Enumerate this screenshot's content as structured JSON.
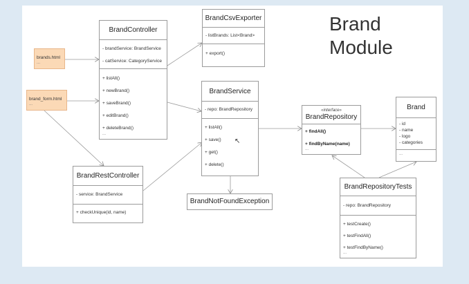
{
  "title": {
    "line1": "Brand",
    "line2": "Module"
  },
  "files": {
    "brands_html": {
      "name": "brands.html",
      "dots": "..."
    },
    "brand_form_html": {
      "name": "brand_form.html",
      "dots": "..."
    }
  },
  "brand_controller": {
    "name": "BrandController",
    "fields": [
      "- brandService: BrandService",
      "- catService: CategoryService"
    ],
    "methods": [
      "+ listAll()",
      "+ newBrand()",
      "+ saveBrand()",
      "+ editBrand()",
      "+ deleteBrand()"
    ],
    "dots": "..."
  },
  "brand_csv_exporter": {
    "name": "BrandCsvExporter",
    "fields": [
      "- listBrands: List<Brand>"
    ],
    "methods": [
      "+ export()"
    ]
  },
  "brand_service": {
    "name": "BrandService",
    "fields": [
      "- repo: BrandRepository"
    ],
    "methods": [
      "+ listAll()",
      "+ save()",
      "+ get()",
      "+ delete()"
    ]
  },
  "brand_repository": {
    "stereotype": "«interface»",
    "name": "BrandRepository",
    "methods": [
      "+ findAll()",
      "+ findByName(name)"
    ],
    "dots": "..."
  },
  "brand": {
    "name": "Brand",
    "fields": [
      "- id",
      "- name",
      "- logo",
      "- categories"
    ],
    "dots": "..."
  },
  "brand_rest_controller": {
    "name": "BrandRestController",
    "fields": [
      "- service: BrandService"
    ],
    "methods": [
      "+ checkUnique(id, name)"
    ]
  },
  "brand_not_found": {
    "name": "BrandNotFoundException"
  },
  "brand_repository_tests": {
    "name": "BrandRepositoryTests",
    "fields": [
      "- repo: BrandRepository"
    ],
    "methods": [
      "+ testCreate()",
      "+ testFindAll()",
      "+ testFindByName()"
    ],
    "dots": "..."
  },
  "colors": {
    "accent_underline": "#e03030",
    "file_fill": "#fbd9b6",
    "border": "#9a9a9a"
  }
}
